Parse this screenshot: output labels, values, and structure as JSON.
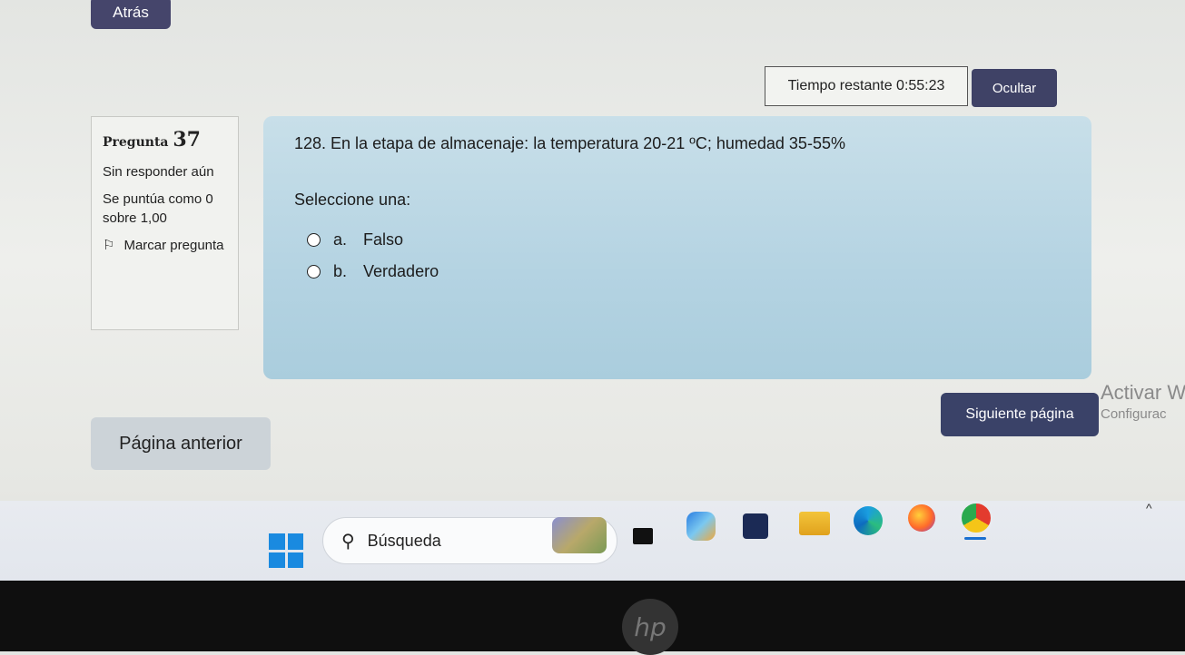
{
  "header": {
    "back_label": "Atrás",
    "timer_label": "Tiempo restante 0:55:23",
    "hide_label": "Ocultar"
  },
  "question_info": {
    "title_word": "Pregunta",
    "number": "37",
    "status": "Sin responder aún",
    "score_label": "Se puntúa como 0 sobre 1,00",
    "flag_label": "Marcar pregunta"
  },
  "question": {
    "text": "128. En la etapa de almacenaje: la temperatura 20-21 ºC; humedad 35-55%",
    "prompt": "Seleccione una:",
    "options": [
      {
        "letter": "a.",
        "label": "Falso",
        "selected": false
      },
      {
        "letter": "b.",
        "label": "Verdadero",
        "selected": false
      }
    ]
  },
  "navigation": {
    "prev_label": "Página anterior",
    "next_label": "Siguiente página"
  },
  "watermark": {
    "line1": "Activar Windo",
    "line2": "Configurac"
  },
  "taskbar": {
    "search_placeholder": "Búsqueda",
    "icons": [
      "windows-start-icon",
      "search-icon",
      "widgets-icon",
      "terminal-icon",
      "copilot-icon",
      "store-icon",
      "file-explorer-icon",
      "edge-icon",
      "firefox-icon",
      "chrome-icon"
    ]
  },
  "hardware": {
    "brand": "hp"
  }
}
